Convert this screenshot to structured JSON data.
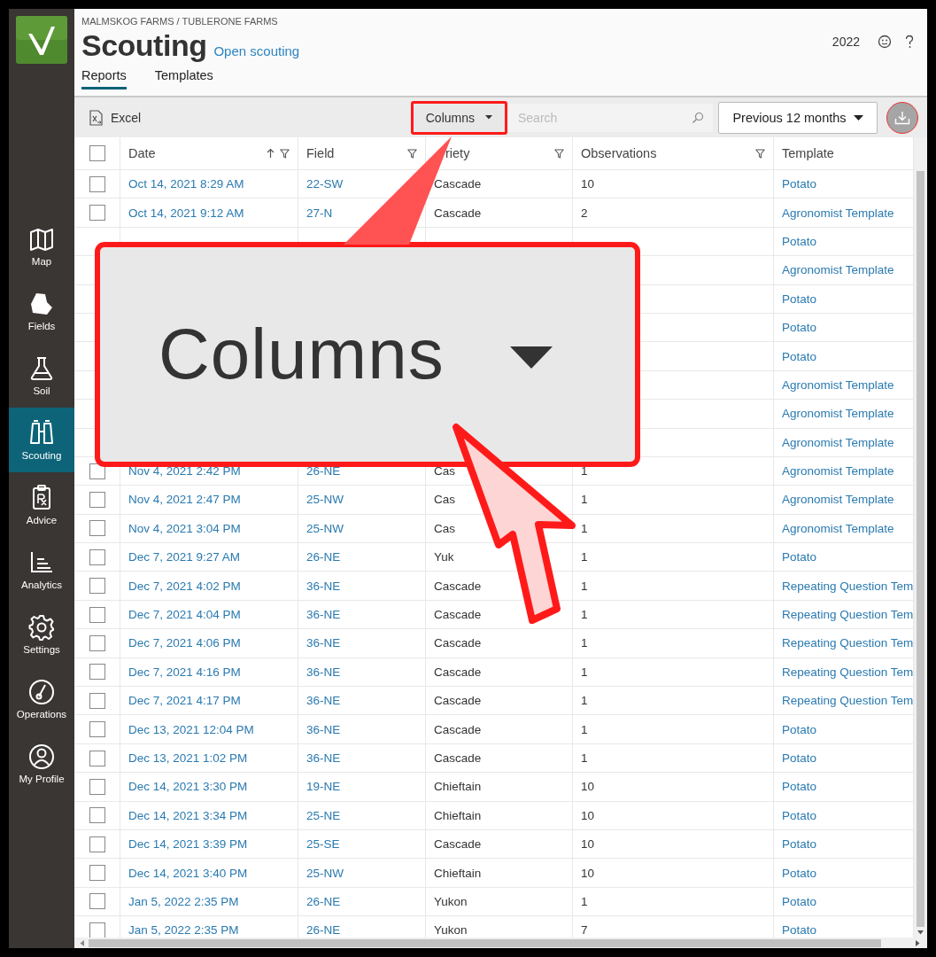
{
  "sidebar": {
    "items": [
      {
        "label": "Map",
        "selected": false
      },
      {
        "label": "Fields",
        "selected": false
      },
      {
        "label": "Soil",
        "selected": false
      },
      {
        "label": "Scouting",
        "selected": true
      },
      {
        "label": "Advice",
        "selected": false
      },
      {
        "label": "Analytics",
        "selected": false
      },
      {
        "label": "Settings",
        "selected": false
      },
      {
        "label": "Operations",
        "selected": false
      },
      {
        "label": "My Profile",
        "selected": false
      }
    ]
  },
  "breadcrumb": "MALMSKOG FARMS / TUBLERONE FARMS",
  "page_title": "Scouting",
  "title_link": "Open scouting",
  "year": "2022",
  "tabs": [
    {
      "label": "Reports",
      "selected": true
    },
    {
      "label": "Templates",
      "selected": false
    }
  ],
  "toolbar": {
    "excel": "Excel",
    "columns_button": {
      "label": "Columns",
      "highlighted": true
    },
    "search": {
      "placeholder": "Search"
    },
    "period": "Previous 12 months"
  },
  "table": {
    "select_all": {
      "checked": false
    },
    "columns": [
      {
        "label": "Date",
        "sorted": true,
        "filterable": true
      },
      {
        "label": "Field",
        "sorted": false,
        "filterable": true
      },
      {
        "label": "riety",
        "sorted": false,
        "filterable": true
      },
      {
        "label": "Observations",
        "sorted": false,
        "filterable": true
      },
      {
        "label": "Template",
        "sorted": false,
        "filterable": false
      }
    ],
    "rows": [
      {
        "checked": false,
        "date": "Oct 14, 2021 8:29 AM",
        "field": "22-SW",
        "variety": "Cascade",
        "observations": "10",
        "template": "Potato"
      },
      {
        "checked": false,
        "date": "Oct 14, 2021 9:12 AM",
        "field": "27-N",
        "variety": "Cascade",
        "observations": "2",
        "template": "Agronomist Template"
      },
      {
        "template": "Potato"
      },
      {
        "template": "Agronomist Template"
      },
      {
        "template": "Potato"
      },
      {
        "template": "Potato"
      },
      {
        "template": "Potato"
      },
      {
        "template": "Agronomist Template"
      },
      {
        "template": "Agronomist Template"
      },
      {
        "template": "Agronomist Template"
      },
      {
        "checked": false,
        "date": "Nov 4, 2021 2:42 PM",
        "field": "26-NE",
        "variety": "Cas",
        "observations": "1",
        "template": "Agronomist Template"
      },
      {
        "checked": false,
        "date": "Nov 4, 2021 2:47 PM",
        "field": "25-NW",
        "variety": "Cas",
        "observations": "1",
        "template": "Agronomist Template"
      },
      {
        "checked": false,
        "date": "Nov 4, 2021 3:04 PM",
        "field": "25-NW",
        "variety": "Cas",
        "observations": "1",
        "template": "Agronomist Template"
      },
      {
        "checked": false,
        "date": "Dec 7, 2021 9:27 AM",
        "field": "26-NE",
        "variety": "Yuk",
        "observations": "1",
        "template": "Potato"
      },
      {
        "checked": false,
        "date": "Dec 7, 2021 4:02 PM",
        "field": "36-NE",
        "variety": "Cascade",
        "observations": "1",
        "template": "Repeating Question Tem"
      },
      {
        "checked": false,
        "date": "Dec 7, 2021 4:04 PM",
        "field": "36-NE",
        "variety": "Cascade",
        "observations": "1",
        "template": "Repeating Question Tem"
      },
      {
        "checked": false,
        "date": "Dec 7, 2021 4:06 PM",
        "field": "36-NE",
        "variety": "Cascade",
        "observations": "1",
        "template": "Repeating Question Tem"
      },
      {
        "checked": false,
        "date": "Dec 7, 2021 4:16 PM",
        "field": "36-NE",
        "variety": "Cascade",
        "observations": "1",
        "template": "Repeating Question Tem"
      },
      {
        "checked": false,
        "date": "Dec 7, 2021 4:17 PM",
        "field": "36-NE",
        "variety": "Cascade",
        "observations": "1",
        "template": "Repeating Question Tem"
      },
      {
        "checked": false,
        "date": "Dec 13, 2021 12:04 PM",
        "field": "36-NE",
        "variety": "Cascade",
        "observations": "1",
        "template": "Potato"
      },
      {
        "checked": false,
        "date": "Dec 13, 2021 1:02 PM",
        "field": "36-NE",
        "variety": "Cascade",
        "observations": "1",
        "template": "Potato"
      },
      {
        "checked": false,
        "date": "Dec 14, 2021 3:30 PM",
        "field": "19-NE",
        "variety": "Chieftain",
        "observations": "10",
        "template": "Potato"
      },
      {
        "checked": false,
        "date": "Dec 14, 2021 3:34 PM",
        "field": "25-NE",
        "variety": "Chieftain",
        "observations": "10",
        "template": "Potato"
      },
      {
        "checked": false,
        "date": "Dec 14, 2021 3:39 PM",
        "field": "25-SE",
        "variety": "Cascade",
        "observations": "10",
        "template": "Potato"
      },
      {
        "checked": false,
        "date": "Dec 14, 2021 3:40 PM",
        "field": "25-NW",
        "variety": "Chieftain",
        "observations": "10",
        "template": "Potato"
      },
      {
        "checked": false,
        "date": "Jan 5, 2022 2:35 PM",
        "field": "26-NE",
        "variety": "Yukon",
        "observations": "1",
        "template": "Potato"
      },
      {
        "checked": false,
        "date": "Jan 5, 2022 2:35 PM",
        "field": "26-NE",
        "variety": "Yukon",
        "observations": "7",
        "template": "Potato"
      }
    ]
  },
  "callout": {
    "label": "Columns"
  }
}
